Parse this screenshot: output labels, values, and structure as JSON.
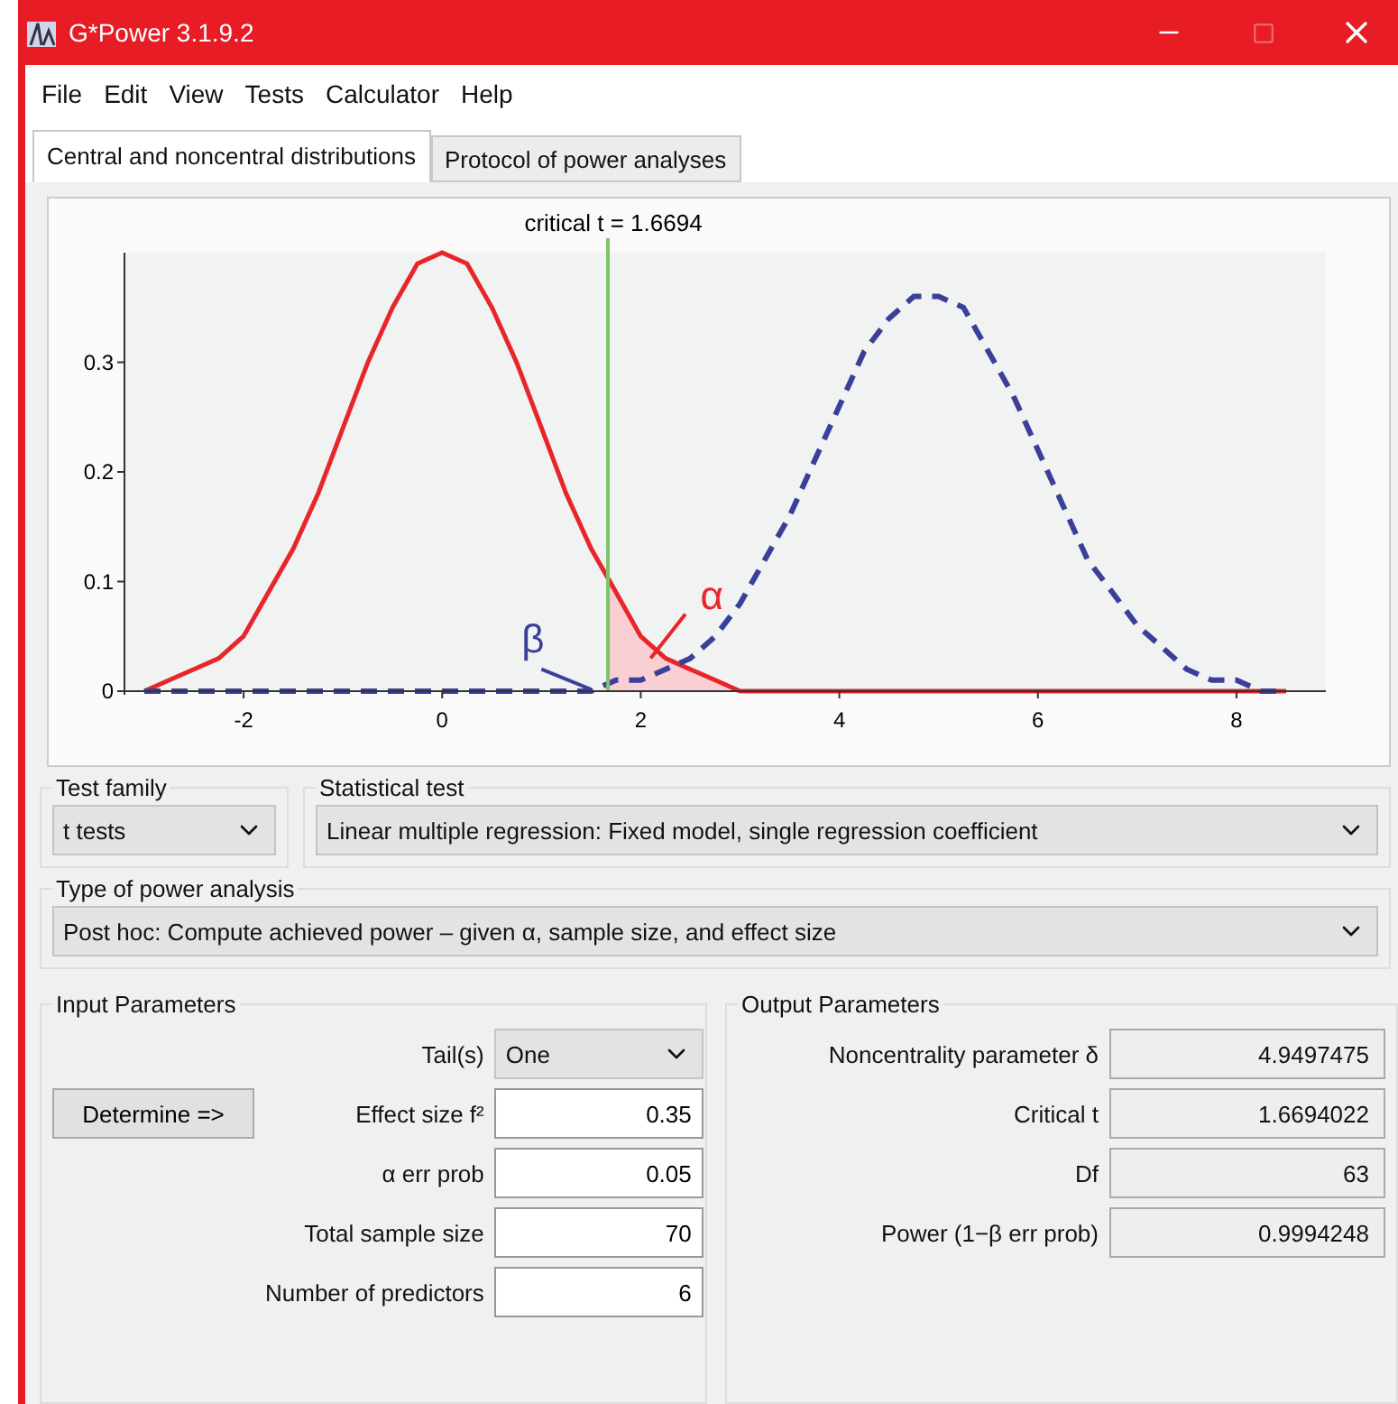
{
  "window": {
    "title": "G*Power 3.1.9.2"
  },
  "menu": [
    "File",
    "Edit",
    "View",
    "Tests",
    "Calculator",
    "Help"
  ],
  "tabs": [
    {
      "label": "Central and noncentral distributions",
      "selected": true
    },
    {
      "label": "Protocol of power analyses",
      "selected": false
    }
  ],
  "distribution_plot": {
    "chart_data": {
      "type": "line",
      "x": [
        -3,
        -2.75,
        -2.5,
        -2.25,
        -2,
        -1.75,
        -1.5,
        -1.25,
        -1,
        -0.75,
        -0.5,
        -0.25,
        0,
        0.25,
        0.5,
        0.75,
        1,
        1.25,
        1.5,
        1.75,
        2,
        2.25,
        2.5,
        2.75,
        3,
        3.25,
        3.5,
        3.75,
        4,
        4.25,
        4.5,
        4.75,
        5,
        5.25,
        5.5,
        5.75,
        6,
        6.25,
        6.5,
        6.75,
        7,
        7.25,
        7.5,
        7.75,
        8,
        8.25,
        8.5
      ],
      "series": [
        {
          "color": "#e8262a",
          "line_style": "solid",
          "values": [
            0,
            0.01,
            0.02,
            0.03,
            0.05,
            0.09,
            0.13,
            0.18,
            0.24,
            0.3,
            0.35,
            0.39,
            0.4,
            0.39,
            0.35,
            0.3,
            0.24,
            0.18,
            0.13,
            0.09,
            0.05,
            0.03,
            0.02,
            0.01,
            0,
            0,
            0,
            0,
            0,
            0,
            0,
            0,
            0,
            0,
            0,
            0,
            0,
            0,
            0,
            0,
            0,
            0,
            0,
            0,
            0,
            0,
            0
          ]
        },
        {
          "color": "#3a3f9a",
          "line_style": "dashed",
          "values": [
            0,
            0,
            0,
            0,
            0,
            0,
            0,
            0,
            0,
            0,
            0,
            0,
            0,
            0,
            0,
            0,
            0,
            0,
            0,
            0.01,
            0.01,
            0.02,
            0.03,
            0.05,
            0.08,
            0.12,
            0.16,
            0.21,
            0.26,
            0.31,
            0.34,
            0.36,
            0.36,
            0.35,
            0.31,
            0.27,
            0.22,
            0.17,
            0.12,
            0.09,
            0.06,
            0.04,
            0.02,
            0.01,
            0.01,
            0,
            0
          ]
        }
      ],
      "xlim": [
        -3.2,
        8.9
      ],
      "ylim": [
        0,
        0.4
      ],
      "xticks": [
        -2,
        0,
        2,
        4,
        6,
        8
      ],
      "yticks": [
        0,
        0.1,
        0.2,
        0.3
      ],
      "ref_lines": [
        {
          "axis": "x",
          "value": 1.6694,
          "label": "critical t = 1.6694"
        }
      ],
      "annotations": [
        "α",
        "β"
      ]
    }
  },
  "test_family": {
    "label": "Test family",
    "value": "t tests"
  },
  "statistical_test": {
    "label": "Statistical test",
    "value": "Linear multiple regression: Fixed model, single regression coefficient"
  },
  "power_analysis_type": {
    "label": "Type of power analysis",
    "value": "Post hoc: Compute achieved power – given α, sample size, and effect size"
  },
  "input_parameters": {
    "title": "Input Parameters",
    "determine_button": "Determine =>",
    "rows": [
      {
        "kind": "select",
        "label": "Tail(s)",
        "value": "One"
      },
      {
        "kind": "input",
        "label": "Effect size f²",
        "value": "0.35"
      },
      {
        "kind": "input",
        "label": "α err prob",
        "value": "0.05"
      },
      {
        "kind": "input",
        "label": "Total sample size",
        "value": "70"
      },
      {
        "kind": "input",
        "label": "Number of predictors",
        "value": "6"
      }
    ]
  },
  "output_parameters": {
    "title": "Output Parameters",
    "rows": [
      {
        "label": "Noncentrality parameter δ",
        "value": "4.9497475"
      },
      {
        "label": "Critical t",
        "value": "1.6694022"
      },
      {
        "label": "Df",
        "value": "63"
      },
      {
        "label": "Power (1−β err prob)",
        "value": "0.9994248"
      }
    ]
  }
}
